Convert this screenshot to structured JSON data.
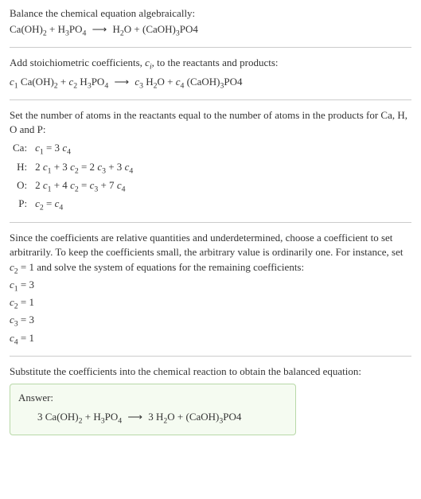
{
  "step1": {
    "intro": "Balance the chemical equation algebraically:",
    "lhs1": "Ca(OH)",
    "lhs1_sub": "2",
    "plus1": " + H",
    "lhs2_sub": "3",
    "lhs2b": "PO",
    "lhs2b_sub": "4",
    "arrow": "⟶",
    "rhs1": "H",
    "rhs1_sub": "2",
    "rhs1b": "O + (CaOH)",
    "rhs2_sub": "3",
    "rhs2b": "PO4"
  },
  "step2": {
    "intro_a": "Add stoichiometric coefficients, ",
    "ci": "c",
    "ci_sub": "i",
    "intro_b": ", to the reactants and products:",
    "c1": "c",
    "c1_sub": "1",
    "sp1": " Ca(OH)",
    "sp1_sub": "2",
    "plus": " + ",
    "c2": "c",
    "c2_sub": "2",
    "sp2a": " H",
    "sp2a_sub": "3",
    "sp2b": "PO",
    "sp2b_sub": "4",
    "arrow": "⟶",
    "c3": "c",
    "c3_sub": "3",
    "sp3a": " H",
    "sp3a_sub": "2",
    "sp3b": "O + ",
    "c4": "c",
    "c4_sub": "4",
    "sp4a": " (CaOH)",
    "sp4a_sub": "3",
    "sp4b": "PO4"
  },
  "step3": {
    "intro": "Set the number of atoms in the reactants equal to the number of atoms in the products for Ca, H, O and P:",
    "rows": {
      "ca_label": "Ca:",
      "ca_eq_a": "c",
      "ca_eq_a_sub": "1",
      "ca_eq_mid": " = 3 ",
      "ca_eq_b": "c",
      "ca_eq_b_sub": "4",
      "h_label": "H:",
      "h_eq_1": "2 ",
      "h_eq_c1": "c",
      "h_eq_c1_sub": "1",
      "h_eq_2": " + 3 ",
      "h_eq_c2": "c",
      "h_eq_c2_sub": "2",
      "h_eq_3": " = 2 ",
      "h_eq_c3": "c",
      "h_eq_c3_sub": "3",
      "h_eq_4": " + 3 ",
      "h_eq_c4": "c",
      "h_eq_c4_sub": "4",
      "o_label": "O:",
      "o_eq_1": "2 ",
      "o_eq_c1": "c",
      "o_eq_c1_sub": "1",
      "o_eq_2": " + 4 ",
      "o_eq_c2": "c",
      "o_eq_c2_sub": "2",
      "o_eq_3": " = ",
      "o_eq_c3": "c",
      "o_eq_c3_sub": "3",
      "o_eq_4": " + 7 ",
      "o_eq_c4": "c",
      "o_eq_c4_sub": "4",
      "p_label": "P:",
      "p_eq_c2": "c",
      "p_eq_c2_sub": "2",
      "p_eq_mid": " = ",
      "p_eq_c4": "c",
      "p_eq_c4_sub": "4"
    }
  },
  "step4": {
    "intro_a": "Since the coefficients are relative quantities and underdetermined, choose a coefficient to set arbitrarily. To keep the coefficients small, the arbitrary value is ordinarily one. For instance, set ",
    "c2": "c",
    "c2_sub": "2",
    "intro_b": " = 1 and solve the system of equations for the remaining coefficients:",
    "l1a": "c",
    "l1a_sub": "1",
    "l1b": " = 3",
    "l2a": "c",
    "l2a_sub": "2",
    "l2b": " = 1",
    "l3a": "c",
    "l3a_sub": "3",
    "l3b": " = 3",
    "l4a": "c",
    "l4a_sub": "4",
    "l4b": " = 1"
  },
  "step5": {
    "intro": "Substitute the coefficients into the chemical reaction to obtain the balanced equation:",
    "answer_label": "Answer:",
    "eq_1": "3 Ca(OH)",
    "eq_1_sub": "2",
    "eq_2": " + H",
    "eq_2_sub": "3",
    "eq_3": "PO",
    "eq_3_sub": "4",
    "arrow": "⟶",
    "eq_4": "3 H",
    "eq_4_sub": "2",
    "eq_5": "O + (CaOH)",
    "eq_5_sub": "3",
    "eq_6": "PO4"
  }
}
